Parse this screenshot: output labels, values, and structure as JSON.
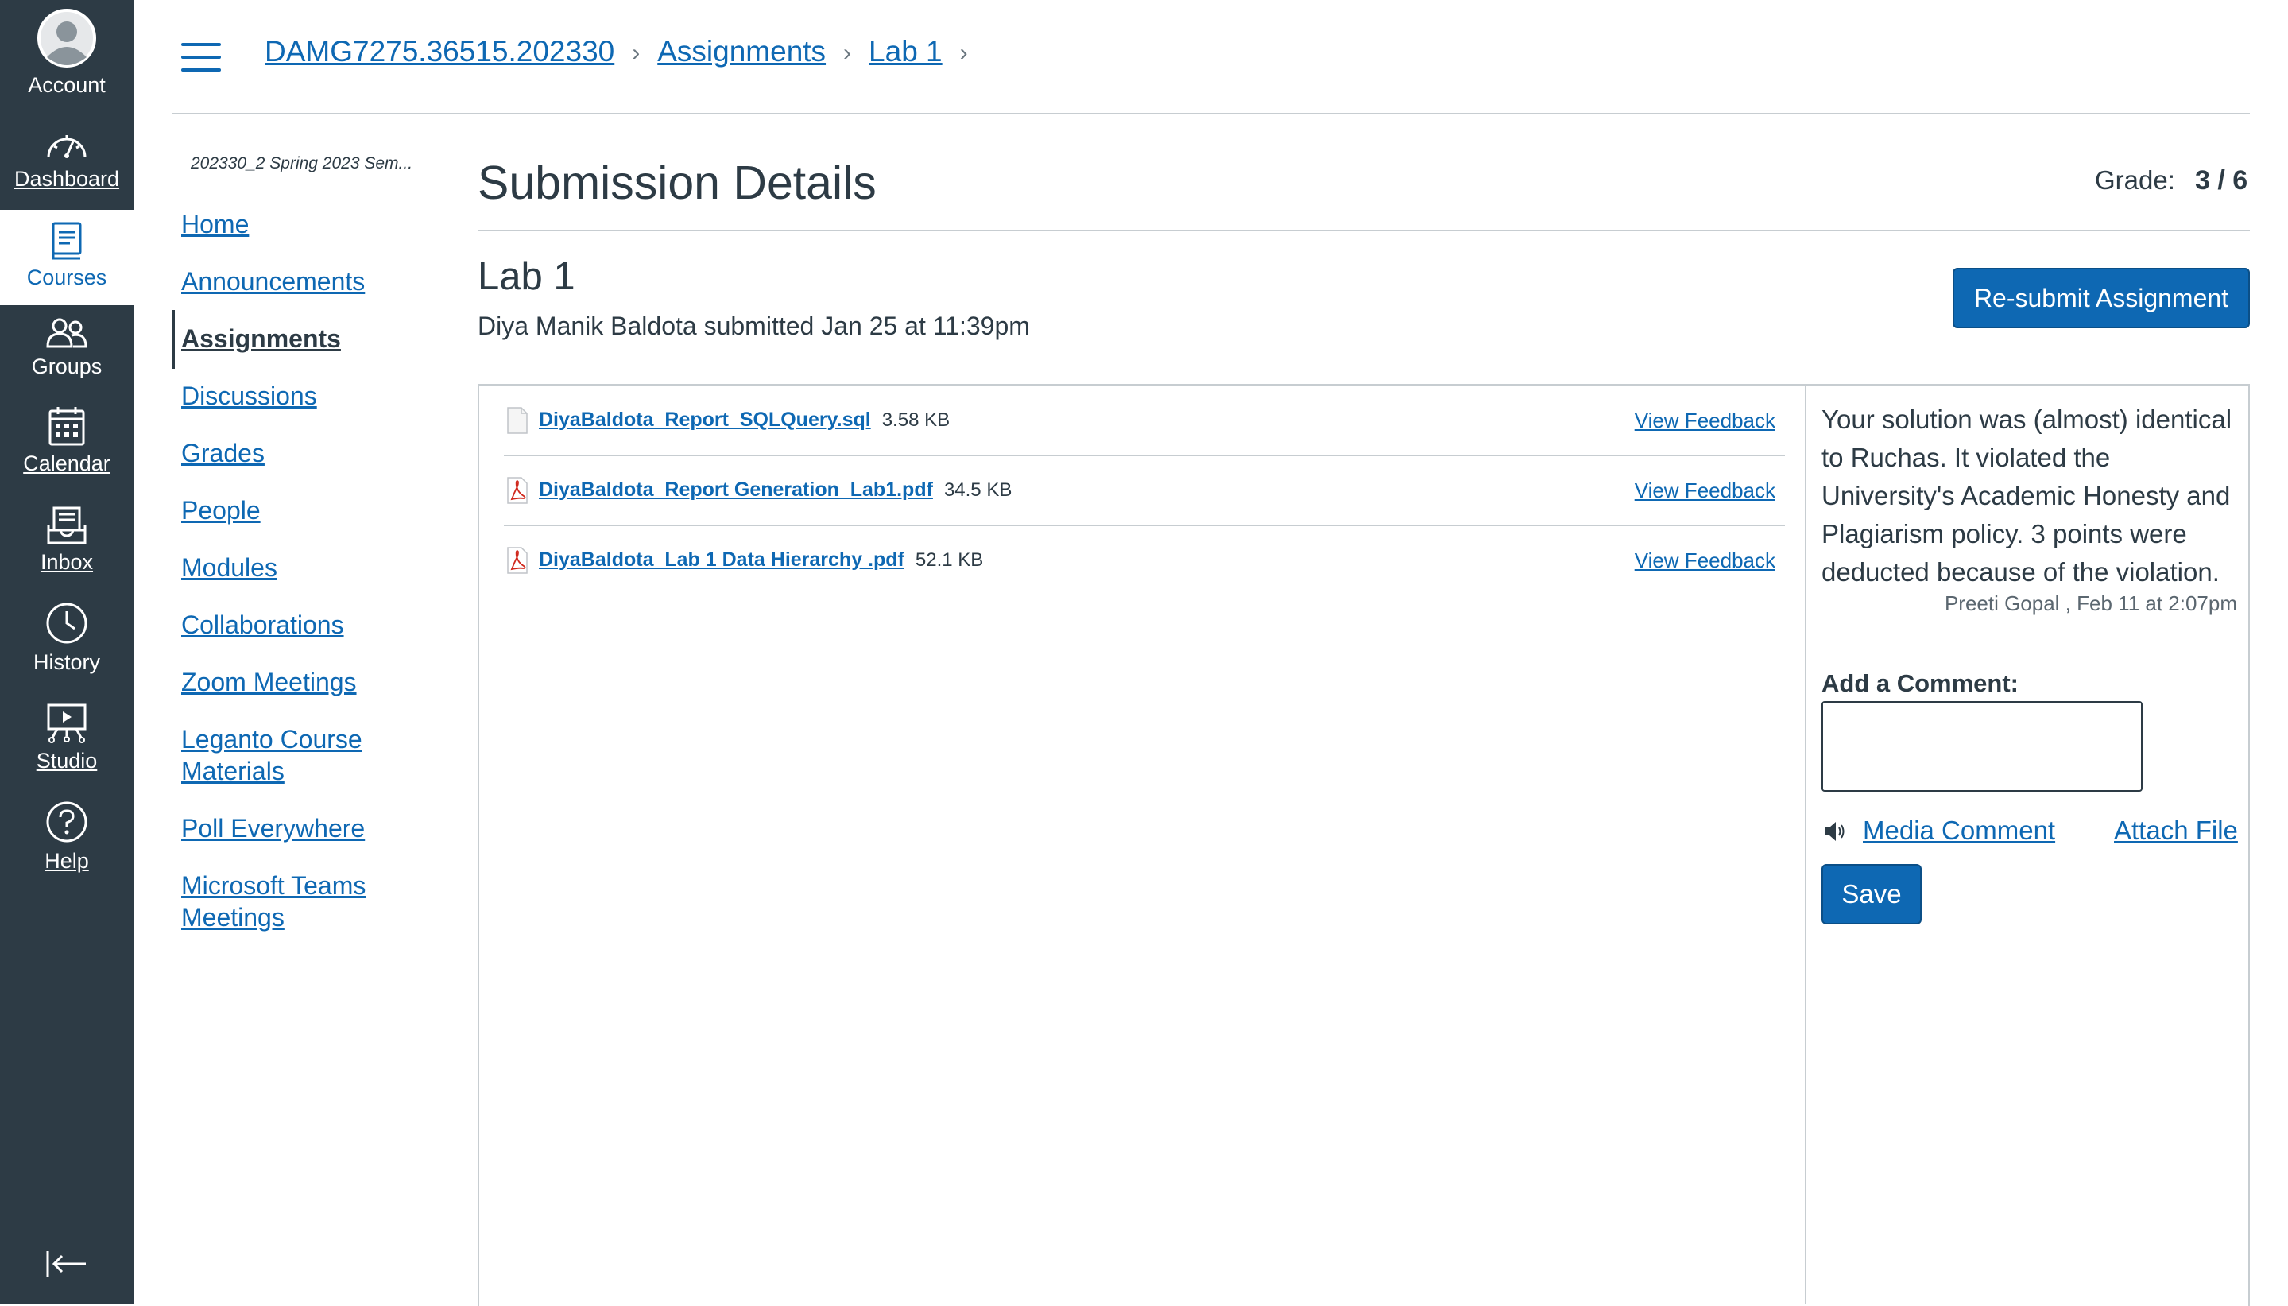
{
  "global_nav": {
    "account": "Account",
    "dashboard": "Dashboard",
    "courses": "Courses",
    "groups": "Groups",
    "calendar": "Calendar",
    "inbox": "Inbox",
    "history": "History",
    "studio": "Studio",
    "help": "Help",
    "active_color": "#0e68b3",
    "background_color": "#2d3b45"
  },
  "breadcrumbs": [
    "DAMG7275.36515.202330",
    "Assignments",
    "Lab 1"
  ],
  "course_nav": {
    "term": "202330_2 Spring 2023 Sem...",
    "items": [
      "Home",
      "Announcements",
      "Assignments",
      "Discussions",
      "Grades",
      "People",
      "Modules",
      "Collaborations",
      "Zoom Meetings",
      "Leganto Course Materials",
      "Poll Everywhere",
      "Microsoft Teams Meetings"
    ],
    "active": "Assignments"
  },
  "main": {
    "title": "Submission Details",
    "grade_label": "Grade:",
    "grade_value": "3 / 6",
    "assignment_name": "Lab 1",
    "submitted_line": "Diya Manik Baldota submitted Jan 25 at 11:39pm",
    "resubmit_label": "Re-submit Assignment"
  },
  "files": [
    {
      "name": "DiyaBaldota_Report_SQLQuery.sql",
      "size": "3.58 KB",
      "type": "generic-file-icon",
      "feedback_label": "View Feedback"
    },
    {
      "name": "DiyaBaldota_Report Generation_Lab1.pdf",
      "size": "34.5 KB",
      "type": "pdf-icon",
      "feedback_label": "View Feedback"
    },
    {
      "name": "DiyaBaldota_Lab 1 Data Hierarchy .pdf",
      "size": "52.1 KB",
      "type": "pdf-icon",
      "feedback_label": "View Feedback"
    }
  ],
  "comments": {
    "items": [
      {
        "text": "Your solution was (almost) identical to Ruchas. It violated the University's Academic Honesty and Plagiarism policy. 3 points were deducted because of the violation.",
        "author": "Preeti Gopal",
        "date": "Feb 11 at 2:07pm",
        "meta": "Preeti Gopal , Feb 11 at 2:07pm"
      }
    ],
    "add_label": "Add a Comment:",
    "comment_value": "",
    "media_comment_label": "Media Comment",
    "attach_file_label": "Attach File",
    "save_label": "Save"
  }
}
